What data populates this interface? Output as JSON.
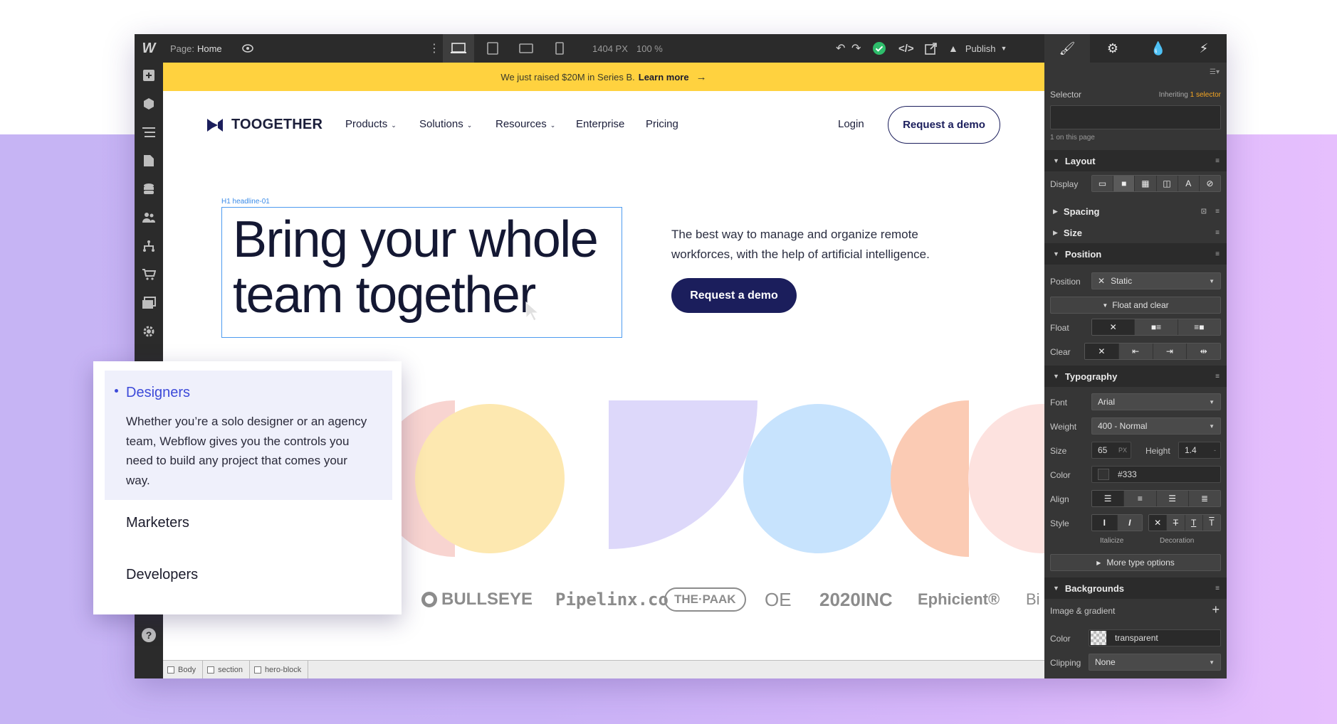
{
  "topbar": {
    "page_label": "Page:",
    "page_name": "Home",
    "viewport_width": "1404 PX",
    "zoom": "100 %",
    "publish": "Publish"
  },
  "left_sidebar": {
    "icons": [
      "add-icon",
      "box-icon",
      "navigator-icon",
      "pages-icon",
      "cms-icon",
      "users-icon",
      "logic-icon",
      "ecommerce-icon",
      "assets-icon",
      "settings-icon",
      "video-icon",
      "help-icon"
    ]
  },
  "site": {
    "banner_text": "We just raised $20M in Series B.",
    "banner_link": "Learn more",
    "brand": "TOOGETHER",
    "nav": [
      "Products",
      "Solutions",
      "Resources",
      "Enterprise",
      "Pricing"
    ],
    "login": "Login",
    "request_demo": "Request a demo",
    "h1_tag": "H1 headline-01",
    "headline": "Bring your whole team together",
    "subtext": "The best way to manage and organize remote workforces, with the help of artificial intelligence.",
    "cta": "Request a demo",
    "logos": [
      "BULLSEYE",
      "Pipelinx.co",
      "THE·PAAK",
      "OE",
      "2020INC",
      "Ephicient®",
      "Bi"
    ]
  },
  "breadcrumb": [
    "Body",
    "section",
    "hero-block"
  ],
  "popup": {
    "active_title": "Designers",
    "active_desc": "Whether you’re a solo designer or an agency team, Webflow gives you the controls you need to build any project that comes your way.",
    "items": [
      "Marketers",
      "Developers"
    ]
  },
  "panel": {
    "selector_label": "Selector",
    "inheriting": "Inheriting",
    "inheriting_count": "1 selector",
    "on_page": "1 on this page",
    "layout": "Layout",
    "display": "Display",
    "spacing": "Spacing",
    "size": "Size",
    "position_section": "Position",
    "position_label": "Position",
    "position_value": "Static",
    "float_and_clear": "Float and clear",
    "float": "Float",
    "clear": "Clear",
    "typography": "Typography",
    "font_label": "Font",
    "font_value": "Arial",
    "weight_label": "Weight",
    "weight_value": "400 - Normal",
    "size_label": "Size",
    "size_value": "65",
    "size_unit": "PX",
    "height_label": "Height",
    "height_value": "1.4",
    "height_unit": "-",
    "color_label": "Color",
    "color_value": "#333",
    "align_label": "Align",
    "style_label": "Style",
    "italicize": "Italicize",
    "decoration": "Decoration",
    "more_type": "More type options",
    "backgrounds": "Backgrounds",
    "image_gradient": "Image & gradient",
    "bg_color_label": "Color",
    "bg_color_value": "transparent",
    "clipping_label": "Clipping",
    "clipping_value": "None"
  },
  "colors": {
    "accent": "#3d4ad9",
    "navy": "#1b1e5c",
    "banner": "#ffd23f",
    "publish_ok": "#2ebd6b",
    "link_orange": "#f5a623"
  }
}
